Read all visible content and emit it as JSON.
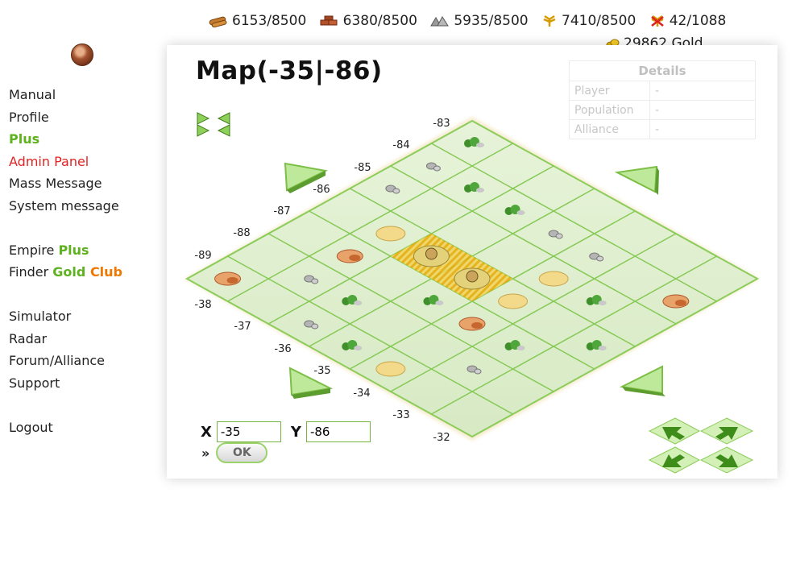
{
  "resources": {
    "wood": "6153/8500",
    "clay": "6380/8500",
    "iron": "5935/8500",
    "crop": "7410/8500",
    "crop_consumption": "42/1088",
    "gold": "29862 Gold"
  },
  "menu": {
    "manual": "Manual",
    "profile": "Profile",
    "plus": "Plus",
    "admin_panel": "Admin Panel",
    "mass_message": "Mass Message",
    "system_message": "System message",
    "empire_label": "Empire ",
    "empire_plus": "Plus",
    "finder_label": "Finder ",
    "finder_gold": "Gold ",
    "finder_club": "Club",
    "simulator": "Simulator",
    "radar": "Radar",
    "forum_alliance": "Forum/Alliance",
    "support": "Support",
    "logout": "Logout"
  },
  "map": {
    "title": "Map(-35|-86)",
    "details": {
      "header": "Details",
      "rows": [
        {
          "label": "Player",
          "value": "-"
        },
        {
          "label": "Population",
          "value": "-"
        },
        {
          "label": "Alliance",
          "value": "-"
        }
      ]
    },
    "y_labels": [
      "-83",
      "-84",
      "-85",
      "-86",
      "-87",
      "-88",
      "-89"
    ],
    "x_labels": [
      "-38",
      "-37",
      "-36",
      "-35",
      "-34",
      "-33",
      "-32"
    ],
    "x_input_label": "X",
    "y_input_label": "Y",
    "x_value": "-35",
    "y_value": "-86",
    "raquo": "»",
    "ok_label": "OK"
  },
  "colors": {
    "accent_green": "#5fb21f",
    "gold_orange": "#f07800",
    "admin_red": "#e32222",
    "grid_line": "#7fc64a",
    "tile_fill": "#dfeecf"
  }
}
